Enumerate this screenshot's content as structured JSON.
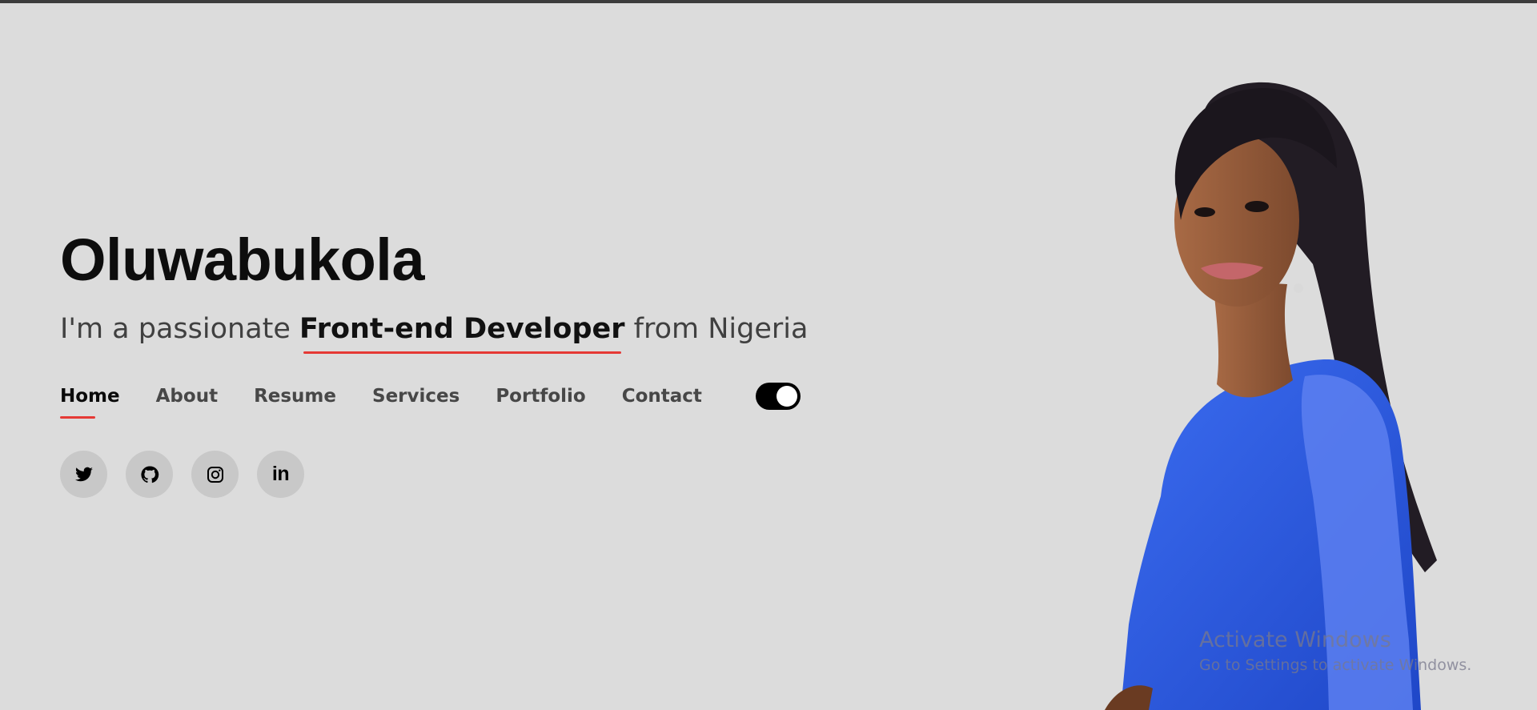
{
  "hero": {
    "name": "Oluwabukola",
    "subtitle_prefix": "I'm a passionate ",
    "subtitle_role": "Front-end Developer",
    "subtitle_suffix": " from Nigeria"
  },
  "nav": {
    "items": [
      {
        "label": "Home",
        "active": true
      },
      {
        "label": "About"
      },
      {
        "label": "Resume"
      },
      {
        "label": "Services"
      },
      {
        "label": "Portfolio"
      },
      {
        "label": "Contact"
      }
    ]
  },
  "theme_toggle": {
    "state": "on"
  },
  "socials": [
    {
      "icon": "twitter-icon"
    },
    {
      "icon": "github-icon"
    },
    {
      "icon": "instagram-icon"
    },
    {
      "icon": "linkedin-icon",
      "text": "in"
    }
  ],
  "watermark": {
    "title": "Activate Windows",
    "subtitle": "Go to Settings to activate Windows."
  },
  "colors": {
    "background": "#dcdcdc",
    "accent": "#e53935",
    "toggle": "#000000",
    "social_bg": "#c8c8c8",
    "dress": "#2f5ee0"
  }
}
